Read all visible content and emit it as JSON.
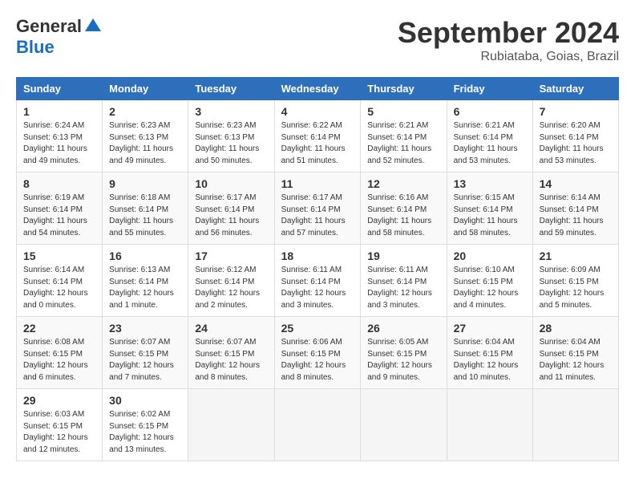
{
  "header": {
    "logo_general": "General",
    "logo_blue": "Blue",
    "month_title": "September 2024",
    "location": "Rubiataba, Goias, Brazil"
  },
  "calendar": {
    "days_of_week": [
      "Sunday",
      "Monday",
      "Tuesday",
      "Wednesday",
      "Thursday",
      "Friday",
      "Saturday"
    ],
    "weeks": [
      [
        {
          "day": "1",
          "info": "Sunrise: 6:24 AM\nSunset: 6:13 PM\nDaylight: 11 hours\nand 49 minutes."
        },
        {
          "day": "2",
          "info": "Sunrise: 6:23 AM\nSunset: 6:13 PM\nDaylight: 11 hours\nand 49 minutes."
        },
        {
          "day": "3",
          "info": "Sunrise: 6:23 AM\nSunset: 6:13 PM\nDaylight: 11 hours\nand 50 minutes."
        },
        {
          "day": "4",
          "info": "Sunrise: 6:22 AM\nSunset: 6:14 PM\nDaylight: 11 hours\nand 51 minutes."
        },
        {
          "day": "5",
          "info": "Sunrise: 6:21 AM\nSunset: 6:14 PM\nDaylight: 11 hours\nand 52 minutes."
        },
        {
          "day": "6",
          "info": "Sunrise: 6:21 AM\nSunset: 6:14 PM\nDaylight: 11 hours\nand 53 minutes."
        },
        {
          "day": "7",
          "info": "Sunrise: 6:20 AM\nSunset: 6:14 PM\nDaylight: 11 hours\nand 53 minutes."
        }
      ],
      [
        {
          "day": "8",
          "info": "Sunrise: 6:19 AM\nSunset: 6:14 PM\nDaylight: 11 hours\nand 54 minutes."
        },
        {
          "day": "9",
          "info": "Sunrise: 6:18 AM\nSunset: 6:14 PM\nDaylight: 11 hours\nand 55 minutes."
        },
        {
          "day": "10",
          "info": "Sunrise: 6:17 AM\nSunset: 6:14 PM\nDaylight: 11 hours\nand 56 minutes."
        },
        {
          "day": "11",
          "info": "Sunrise: 6:17 AM\nSunset: 6:14 PM\nDaylight: 11 hours\nand 57 minutes."
        },
        {
          "day": "12",
          "info": "Sunrise: 6:16 AM\nSunset: 6:14 PM\nDaylight: 11 hours\nand 58 minutes."
        },
        {
          "day": "13",
          "info": "Sunrise: 6:15 AM\nSunset: 6:14 PM\nDaylight: 11 hours\nand 58 minutes."
        },
        {
          "day": "14",
          "info": "Sunrise: 6:14 AM\nSunset: 6:14 PM\nDaylight: 11 hours\nand 59 minutes."
        }
      ],
      [
        {
          "day": "15",
          "info": "Sunrise: 6:14 AM\nSunset: 6:14 PM\nDaylight: 12 hours\nand 0 minutes."
        },
        {
          "day": "16",
          "info": "Sunrise: 6:13 AM\nSunset: 6:14 PM\nDaylight: 12 hours\nand 1 minute."
        },
        {
          "day": "17",
          "info": "Sunrise: 6:12 AM\nSunset: 6:14 PM\nDaylight: 12 hours\nand 2 minutes."
        },
        {
          "day": "18",
          "info": "Sunrise: 6:11 AM\nSunset: 6:14 PM\nDaylight: 12 hours\nand 3 minutes."
        },
        {
          "day": "19",
          "info": "Sunrise: 6:11 AM\nSunset: 6:14 PM\nDaylight: 12 hours\nand 3 minutes."
        },
        {
          "day": "20",
          "info": "Sunrise: 6:10 AM\nSunset: 6:15 PM\nDaylight: 12 hours\nand 4 minutes."
        },
        {
          "day": "21",
          "info": "Sunrise: 6:09 AM\nSunset: 6:15 PM\nDaylight: 12 hours\nand 5 minutes."
        }
      ],
      [
        {
          "day": "22",
          "info": "Sunrise: 6:08 AM\nSunset: 6:15 PM\nDaylight: 12 hours\nand 6 minutes."
        },
        {
          "day": "23",
          "info": "Sunrise: 6:07 AM\nSunset: 6:15 PM\nDaylight: 12 hours\nand 7 minutes."
        },
        {
          "day": "24",
          "info": "Sunrise: 6:07 AM\nSunset: 6:15 PM\nDaylight: 12 hours\nand 8 minutes."
        },
        {
          "day": "25",
          "info": "Sunrise: 6:06 AM\nSunset: 6:15 PM\nDaylight: 12 hours\nand 8 minutes."
        },
        {
          "day": "26",
          "info": "Sunrise: 6:05 AM\nSunset: 6:15 PM\nDaylight: 12 hours\nand 9 minutes."
        },
        {
          "day": "27",
          "info": "Sunrise: 6:04 AM\nSunset: 6:15 PM\nDaylight: 12 hours\nand 10 minutes."
        },
        {
          "day": "28",
          "info": "Sunrise: 6:04 AM\nSunset: 6:15 PM\nDaylight: 12 hours\nand 11 minutes."
        }
      ],
      [
        {
          "day": "29",
          "info": "Sunrise: 6:03 AM\nSunset: 6:15 PM\nDaylight: 12 hours\nand 12 minutes."
        },
        {
          "day": "30",
          "info": "Sunrise: 6:02 AM\nSunset: 6:15 PM\nDaylight: 12 hours\nand 13 minutes."
        },
        {
          "day": "",
          "info": ""
        },
        {
          "day": "",
          "info": ""
        },
        {
          "day": "",
          "info": ""
        },
        {
          "day": "",
          "info": ""
        },
        {
          "day": "",
          "info": ""
        }
      ]
    ]
  }
}
